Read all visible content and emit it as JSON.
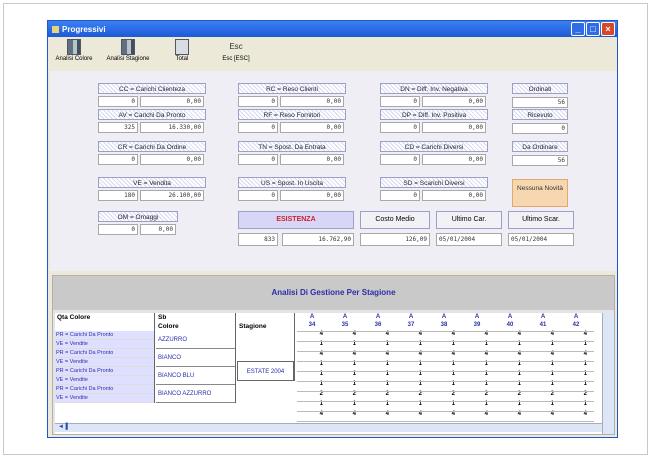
{
  "window": {
    "title": "Progressivi"
  },
  "toolbar": [
    {
      "label": "Analisi Colore",
      "icon": "chart-icon"
    },
    {
      "label": "Analisi Stagione",
      "icon": "chart-icon"
    },
    {
      "label": "Total",
      "icon": "document-icon"
    },
    {
      "label": "Esc [ESC]",
      "icon": "exit-icon"
    }
  ],
  "fields": [
    {
      "label": "CC = Carichi Clienteza",
      "v1": "0",
      "v2": "0,00"
    },
    {
      "label": "AV = Carichi Da Pronto",
      "v1": "325",
      "v2": "16.330,00"
    },
    {
      "label": "CR = Carichi Da Ordine",
      "v1": "0",
      "v2": "0,00"
    },
    {
      "label": "VE = Vendita",
      "v1": "180",
      "v2": "26.100,00"
    },
    {
      "label": "OM = Omaggi",
      "v1": "0",
      "v2": "0,00"
    },
    {
      "label": "RC = Reso Clienti",
      "v1": "0",
      "v2": "0,00"
    },
    {
      "label": "RF = Reso Fornitori",
      "v1": "0",
      "v2": "0,00"
    },
    {
      "label": "TN = Spost. Da Entrata",
      "v1": "0",
      "v2": "0,00"
    },
    {
      "label": "US = Spost. In Uscita",
      "v1": "0",
      "v2": "0,00"
    },
    {
      "label": "DN = Diff. Inv. Negativa",
      "v1": "0",
      "v2": "0,00"
    },
    {
      "label": "DP = Diff. Inv. Positiva",
      "v1": "0",
      "v2": "0,00"
    },
    {
      "label": "CD = Carichi Diversi",
      "v1": "0",
      "v2": "0,00"
    },
    {
      "label": "SD = Scarichi Diversi",
      "v1": "0",
      "v2": "0,00"
    }
  ],
  "side": [
    {
      "label": "Ordinati",
      "value": "56"
    },
    {
      "label": "Ricevuto",
      "value": "0"
    },
    {
      "label": "Da Ordinare",
      "value": "56"
    }
  ],
  "message": "Nessuna Novità",
  "summary": {
    "esistenza_label": "ESISTENZA",
    "esistenza_qty": "833",
    "esistenza_val": "16.762,90",
    "costo_label": "Costo Medio",
    "costo_val": "126,09",
    "ultimo_car_label": "Ultimo Car.",
    "ultimo_car_val": "05/01/2004",
    "ultimo_scar_label": "Ultimo Scar.",
    "ultimo_scar_val": "05/01/2004"
  },
  "analysis": {
    "title": "Analisi Di Gestione Per Stagione",
    "col_headers": [
      "Qta Colore",
      "Sb",
      "Colore",
      "Stagione"
    ],
    "stagione": "ESTATE 2004",
    "sizes": [
      "34",
      "35",
      "36",
      "37",
      "38",
      "39",
      "40",
      "41",
      "42"
    ],
    "rows": [
      {
        "colore": "AZZURRO",
        "pr": "PR = Carichi Da Pronto",
        "ve": "VE = Vendite"
      },
      {
        "colore": "BIANCO",
        "pr": "PR = Carichi Da Pronto",
        "ve": "VE = Vendite"
      },
      {
        "colore": "BIANCO BLU",
        "pr": "PR = Carichi Da Pronto",
        "ve": "VE = Vendite"
      },
      {
        "colore": "BIANCO AZZURRO",
        "pr": "PR = Carichi Da Pronto",
        "ve": "VE = Vendite"
      }
    ],
    "values": [
      [
        "4",
        "4",
        "4",
        "4",
        "4",
        "4",
        "4",
        "4",
        "4"
      ],
      [
        "1",
        "1",
        "1",
        "1",
        "1",
        "1",
        "1",
        "1",
        "1"
      ],
      [
        "4",
        "4",
        "4",
        "4",
        "4",
        "4",
        "4",
        "4",
        "4"
      ],
      [
        "1",
        "1",
        "1",
        "1",
        "1",
        "1",
        "1",
        "1",
        "1"
      ],
      [
        "1",
        "1",
        "1",
        "1",
        "1",
        "1",
        "1",
        "1",
        "1"
      ],
      [
        "1",
        "1",
        "1",
        "1",
        "1",
        "1",
        "1",
        "1",
        "1"
      ],
      [
        "2",
        "2",
        "2",
        "2",
        "2",
        "2",
        "2",
        "2",
        "2"
      ],
      [
        "1",
        "1",
        "1",
        "1",
        "1",
        "1",
        "1",
        "1",
        "1"
      ],
      [
        "4",
        "4",
        "4",
        "4",
        "4",
        "4",
        "4",
        "4",
        "4"
      ]
    ]
  }
}
